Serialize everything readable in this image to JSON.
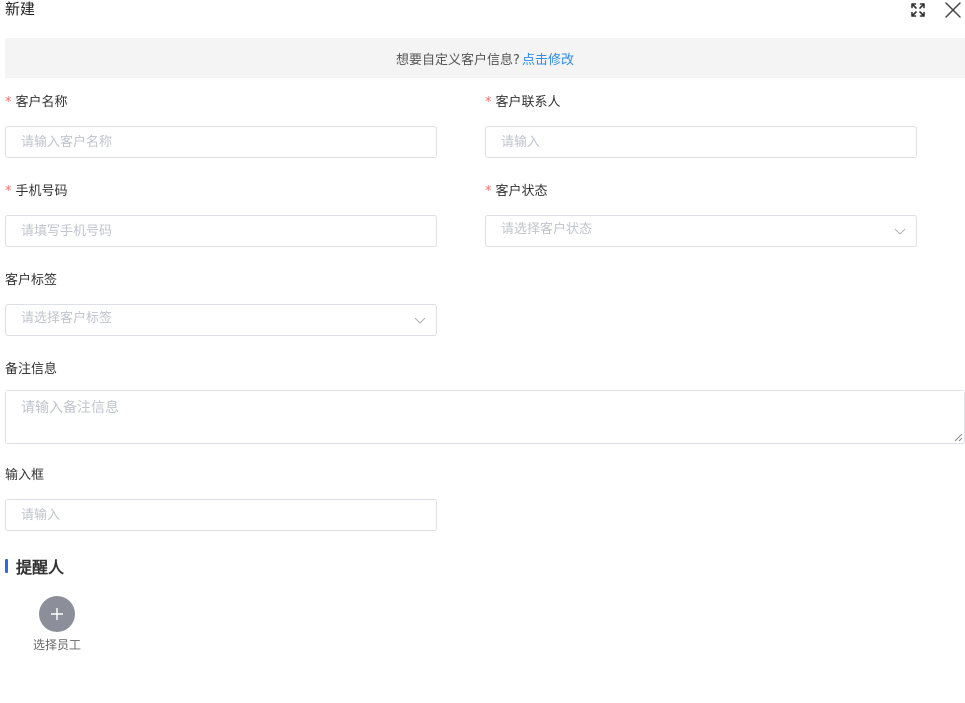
{
  "dialog": {
    "title": "新建"
  },
  "notice": {
    "text": "想要自定义客户信息?",
    "link": "点击修改"
  },
  "fields": {
    "customer_name": {
      "label": "客户名称",
      "required_mark": "*",
      "placeholder": "请输入客户名称"
    },
    "contact": {
      "label": "客户联系人",
      "required_mark": "*",
      "placeholder": "请输入"
    },
    "phone": {
      "label": "手机号码",
      "required_mark": "*",
      "placeholder": "请填写手机号码"
    },
    "status": {
      "label": "客户状态",
      "required_mark": "*",
      "placeholder": "请选择客户状态"
    },
    "tags": {
      "label": "客户标签",
      "placeholder": "请选择客户标签"
    },
    "remark": {
      "label": "备注信息",
      "placeholder": "请输入备注信息"
    },
    "input_box": {
      "label": "输入框",
      "placeholder": "请输入"
    }
  },
  "reminder": {
    "section_title": "提醒人",
    "add_label": "选择员工"
  },
  "colors": {
    "accent": "#2d8cf0",
    "required": "#f56c6c",
    "section_bar": "#2d6ce0"
  }
}
